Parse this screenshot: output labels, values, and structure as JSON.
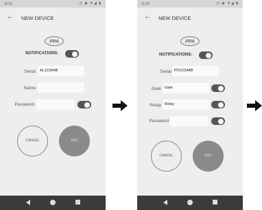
{
  "colors": {
    "toggle": "#555555",
    "add_button": "#8a8a8a",
    "screen_bg": "#eeeeee",
    "navbar": "#3b3b3b"
  },
  "screen1": {
    "status_time": "11:31",
    "status_icons": "◷ ◉ ▼◢ ▮",
    "title": "NEW DEVICE",
    "logo_text": "PPA",
    "notifications_label": "NOTIFICATIONS:",
    "serial_label": "Serial",
    "serial_value": "AL1234AB",
    "name_label": "Name",
    "name_value": "",
    "password_label": "Password",
    "password_value": "",
    "cancel_label": "CANCEL",
    "add_label": "ADD"
  },
  "screen2": {
    "status_time": "11:31",
    "status_icons": "◷ ◉ ▼◢ ▮",
    "title": "NEW DEVICE",
    "logo_text": "PPA",
    "notifications_label": "NOTIFICATIONS:",
    "serial_label": "Serial",
    "serial_value": "PO1234AB",
    "gate_label": "Gate",
    "gate_value": "Gate",
    "relay_label": "Relay",
    "relay_value": "Relay",
    "password_label": "Password",
    "password_value": "",
    "cancel_label": "CANCEL",
    "add_label": "ADD"
  },
  "icons": {
    "back": "arrow-left",
    "flow": "arrow-right",
    "nav_back": "triangle-left",
    "nav_home": "circle",
    "nav_recent": "square"
  }
}
